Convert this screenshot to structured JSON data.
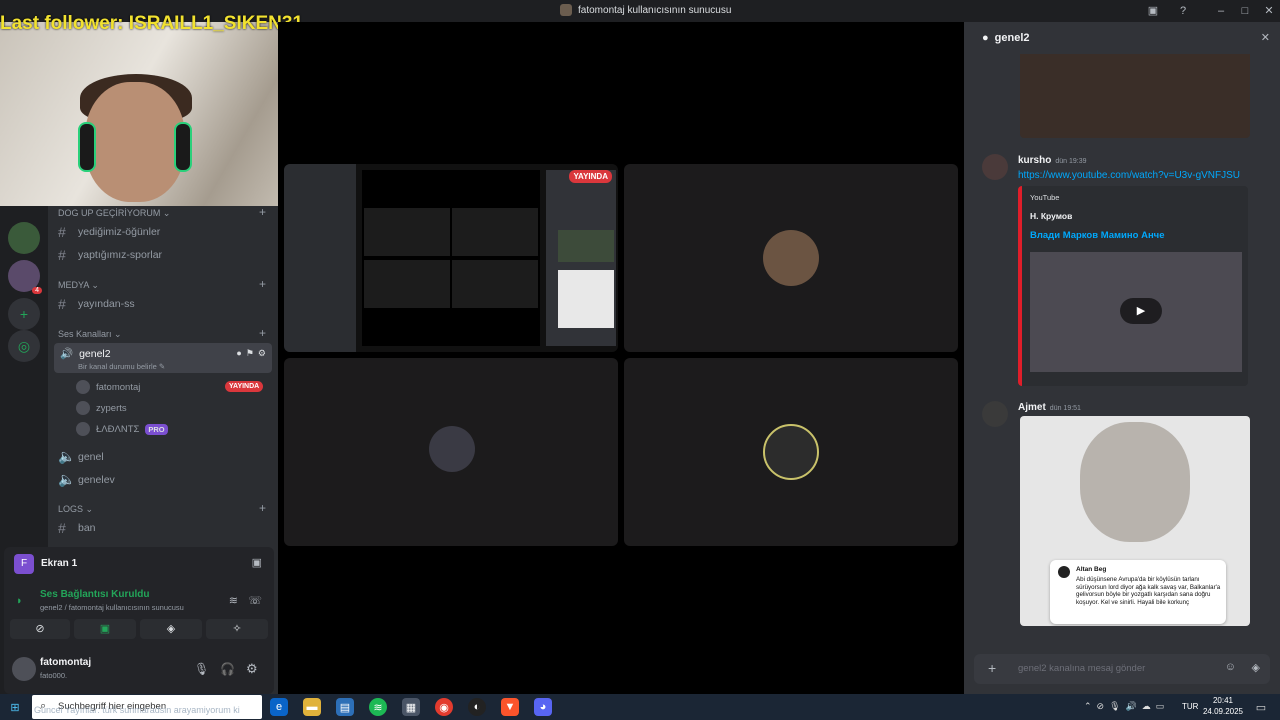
{
  "window": {
    "title": "fatomontaj kullanıcısının sunucusu"
  },
  "overlay": {
    "last_follower": "Last follower: ISRAILL1_SIKEN31"
  },
  "channels": {
    "cat_dog": "DOG UP GEÇİRİYORUM",
    "ch_yedigimiz": "yediğimiz-öğünler",
    "ch_yaptigimiz": "yaptığımız-sporlar",
    "cat_medya": "MEDYA",
    "ch_yayindan": "yayından-ss",
    "cat_ses": "Ses Kanalları",
    "voice_genel2": "genel2",
    "voice_genel2_status": "Bir kanal durumu belirle",
    "user1": "fatomontaj",
    "user1_badge": "YAYINDA",
    "user2": "zyperts",
    "user3": "ŁΛÐΛΝΤΣ",
    "user3_badge": "PRO",
    "voice_genel": "genel",
    "voice_genelev": "genelev",
    "cat_logs": "LOGS",
    "ch_ban": "ban"
  },
  "server_badge": "4",
  "panel": {
    "screen_label": "Ekran 1",
    "screen_initial": "F",
    "voice_connected": "Ses Bağlantısı Kuruldu",
    "voice_sub": "genel2 / fatomontaj kullanıcısının sunucusu",
    "username": "fatomontaj",
    "usertag": "fato000."
  },
  "stage": {
    "live_badge": "YAYINDA"
  },
  "chat": {
    "channel": "genel2",
    "msg1_author": "kursho",
    "msg1_time": "dün 19:39",
    "msg1_link": "https://www.youtube.com/watch?v=U3v-gVNFJSU",
    "embed_provider": "YouTube",
    "embed_author": "Н. Крумов",
    "embed_title": "Влади Марков  Мамино Анче",
    "msg2_author": "Ajmet",
    "msg2_time": "dün 19:51",
    "img_name": "Altan Beg",
    "img_text": "Abi düşünsene Avrupa'da bir köylüsün tarlanı sürüyorsun lord diyor ağa kalk savaş var, Balkanlar'a gelivorsun böyle bir yozgatlı karşıdan sana doğru koşuyor. Kel ve sinirli. Hayali bile korkunç",
    "input_placeholder": "genel2 kanalına mesaj gönder"
  },
  "taskbar": {
    "search_placeholder": "Suchbegriff hier eingeben",
    "marquee": "Güncel Yayınlar: türk sunmaradsin arayamiyorum ki",
    "lang": "TUR",
    "time": "20:41",
    "date": "24.09.2025"
  },
  "colors": {
    "accent": "#5865f2",
    "live": "#da373c",
    "online": "#23a559",
    "taskbar": "#1b2635"
  }
}
